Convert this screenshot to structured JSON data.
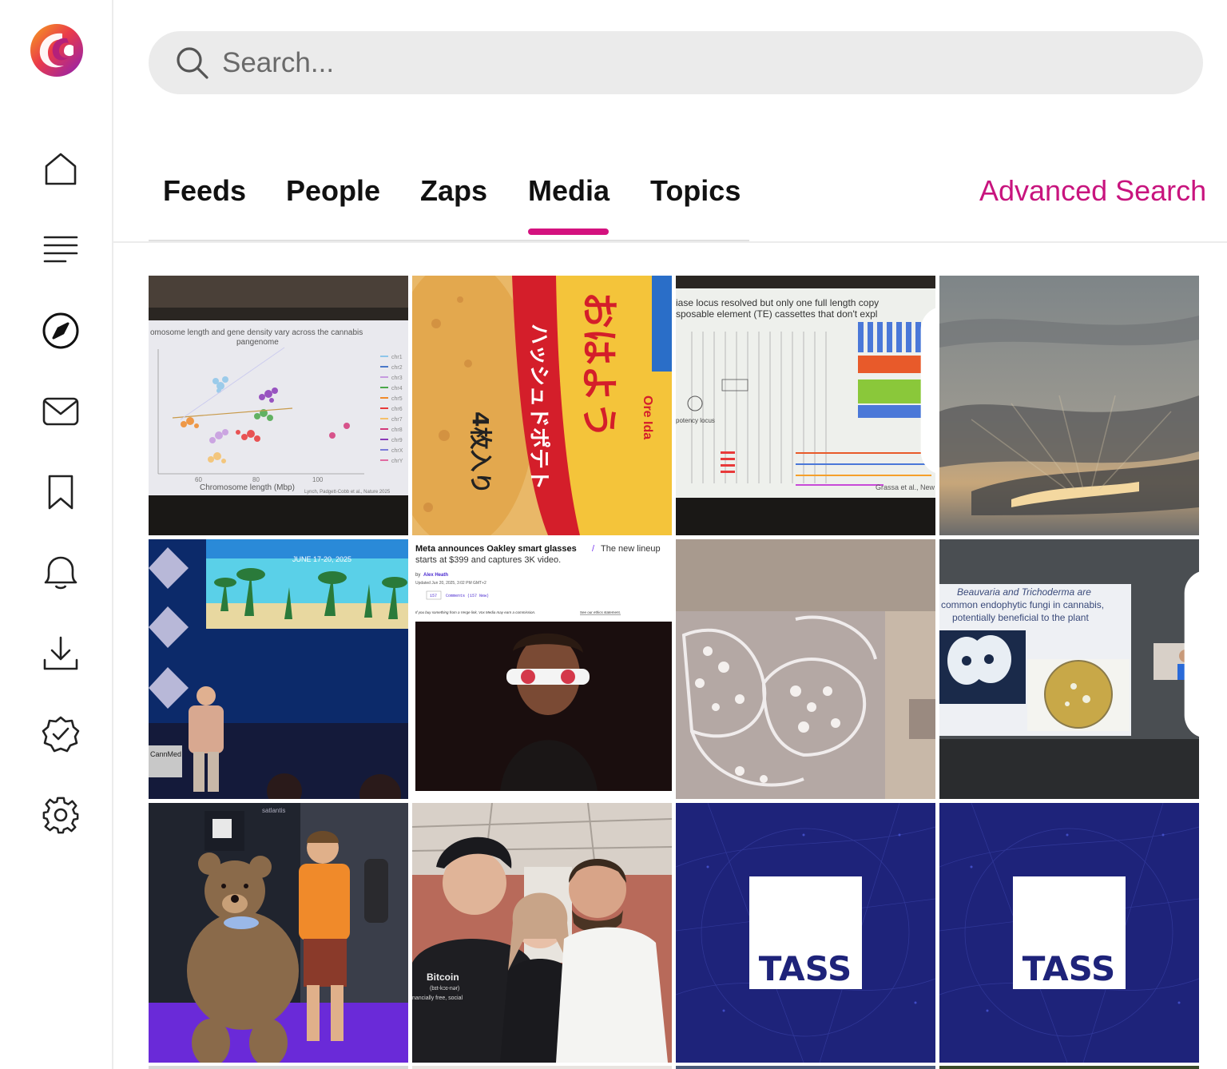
{
  "search": {
    "placeholder": "Search..."
  },
  "tabs": [
    {
      "label": "Feeds"
    },
    {
      "label": "People"
    },
    {
      "label": "Zaps"
    },
    {
      "label": "Media"
    },
    {
      "label": "Topics"
    }
  ],
  "active_tab": "Media",
  "advanced_search_label": "Advanced Search",
  "colors": {
    "accent": "#c8147e",
    "tab_underline": "#d4127f",
    "search_bg": "#ebebeb"
  },
  "sidebar": {
    "items": [
      {
        "icon": "home-icon"
      },
      {
        "icon": "feed-list-icon"
      },
      {
        "icon": "compass-icon"
      },
      {
        "icon": "mail-icon"
      },
      {
        "icon": "bookmark-icon"
      },
      {
        "icon": "bell-icon"
      },
      {
        "icon": "download-icon"
      },
      {
        "icon": "verified-badge-icon"
      },
      {
        "icon": "settings-icon"
      }
    ]
  },
  "media": {
    "t1": {
      "title": "omosome length and gene density vary across the cannabis",
      "subtitle": "pangenome",
      "xlabel": "Chromosome length (Mbp)",
      "ticks": [
        "60",
        "80",
        "100"
      ],
      "cite": "Lynch, Padgett-Cobb et al., Nature 2025",
      "legend": [
        "chr1",
        "chr2",
        "chr3",
        "chr4",
        "chr5",
        "chr6",
        "chr7",
        "chr8",
        "chr9",
        "chrX",
        "chrY"
      ]
    },
    "t2": {
      "text1": "おはよう",
      "text2": "ハッシュドポテト",
      "text3": "4枚入り",
      "text4": "Ore Ida"
    },
    "t3": {
      "line1": "iase locus resolved but only one full length copy",
      "line2": "sposable element (TE) cassettes that don't expl",
      "label": "potency locus",
      "cite": "Grassa et al., New"
    },
    "t5": {
      "date": "JUNE 17-20, 2025",
      "brand": "CannMed"
    },
    "t6": {
      "headline": "Meta announces Oakley smart glasses",
      "sep": "/",
      "deck1": "The new lineup",
      "deck2": "starts at $399 and captures 3K video.",
      "byline": "by",
      "author": "Alex Heath",
      "updated": "Updated Jun 20, 2025, 3:02 PM GMT+2",
      "comments_count": "157",
      "comments_label": "Comments (157 New)",
      "disclaimer": "If you buy something from a Verge link, Vox Media may earn a commission.",
      "ethics_link": "See our ethics statement."
    },
    "t8": {
      "line1": "Beauvaria and Trichoderma are",
      "line2": "common endophytic fungi in cannabis,",
      "line3": "potentially beneficial to the plant"
    },
    "t9": {
      "brand": "satlantis"
    },
    "t10": {
      "shirt1": "Bitcoin",
      "shirt2": "(bɪt-kɔɪ-nər)",
      "shirt3": "nancially free, social"
    },
    "t11": {
      "logo": "TASS"
    },
    "t12": {
      "logo": "TASS"
    }
  }
}
